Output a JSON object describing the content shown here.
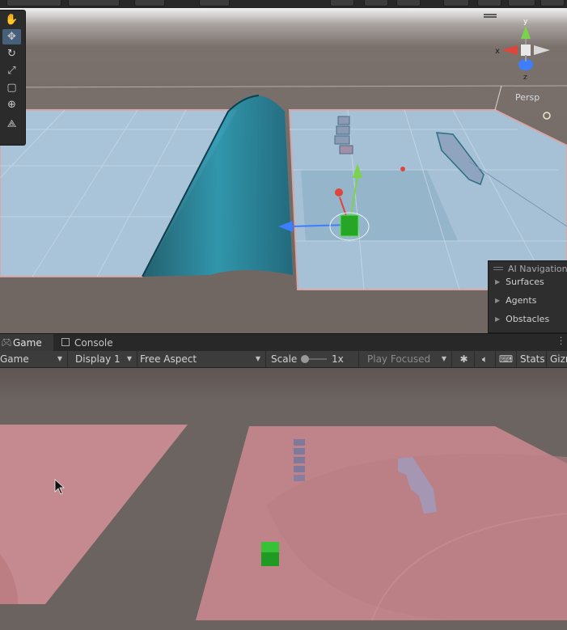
{
  "scene": {
    "persp_label": "Persp",
    "gizmo_axes": {
      "x": "x",
      "y": "y",
      "z": "z"
    },
    "tools": [
      {
        "name": "hand-tool",
        "icon": "hand-icon"
      },
      {
        "name": "move-tool",
        "icon": "move-arrows-icon",
        "active": true
      },
      {
        "name": "rotate-tool",
        "icon": "rotate-icon"
      },
      {
        "name": "scale-tool",
        "icon": "scale-icon"
      },
      {
        "name": "rect-tool",
        "icon": "rect-icon"
      },
      {
        "name": "transform-tool",
        "icon": "transform-icon"
      },
      {
        "name": "custom-tool",
        "icon": "custom-tool-icon"
      }
    ],
    "ai_navigation": {
      "title": "AI Navigation",
      "items": [
        "Surfaces",
        "Agents",
        "Obstacles"
      ]
    }
  },
  "tabs": {
    "game": "Game",
    "console": "Console"
  },
  "game_toolbar": {
    "mode": "Game",
    "display": "Display 1",
    "aspect": "Free Aspect",
    "scale_label": "Scale",
    "scale_value": "1x",
    "play_mode": "Play Focused",
    "stats": "Stats",
    "gizmos": "Gizr"
  },
  "colors": {
    "accent_active": "#46607c",
    "navmesh_blue": "#a6c1d6",
    "ground_pink": "#c48a8f",
    "x_axis": "#e0453b",
    "y_axis": "#7ad34b",
    "z_axis": "#3f7dff"
  }
}
